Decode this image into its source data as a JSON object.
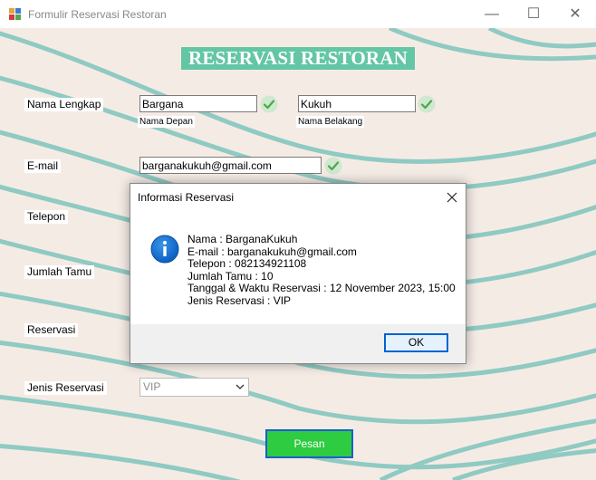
{
  "window": {
    "title": "Formulir Reservasi Restoran",
    "minimize_glyph": "—",
    "maximize_glyph": "☐",
    "close_glyph": "✕"
  },
  "heading": "RESERVASI RESTORAN",
  "form": {
    "nama_label": "Nama Lengkap",
    "first_name": "Bargana",
    "first_name_caption": "Nama Depan",
    "last_name": "Kukuh",
    "last_name_caption": "Nama Belakang",
    "email_label": "E-mail",
    "email": "barganakukuh@gmail.com",
    "telepon_label": "Telepon",
    "jumlah_label": "Jumlah Tamu",
    "reservasi_label": "Reservasi",
    "jenis_label": "Jenis Reservasi",
    "jenis_value": "VIP",
    "submit_label": "Pesan"
  },
  "dialog": {
    "title": "Informasi Reservasi",
    "lines": [
      "Nama : BarganaKukuh",
      "E-mail : barganakukuh@gmail.com",
      "Telepon : 082134921108",
      "Jumlah Tamu : 10",
      "Tanggal & Waktu Reservasi : 12 November 2023, 15:00",
      "Jenis Reservasi : VIP"
    ],
    "ok_label": "OK"
  },
  "icons": {
    "check": "check-circle-icon",
    "info": "info-icon"
  },
  "colors": {
    "heading_bg": "#63c6a4",
    "wave": "#8fcac3",
    "background": "#f5ebe5",
    "submit_bg": "#2ecc40",
    "check": "#5cb85c"
  }
}
